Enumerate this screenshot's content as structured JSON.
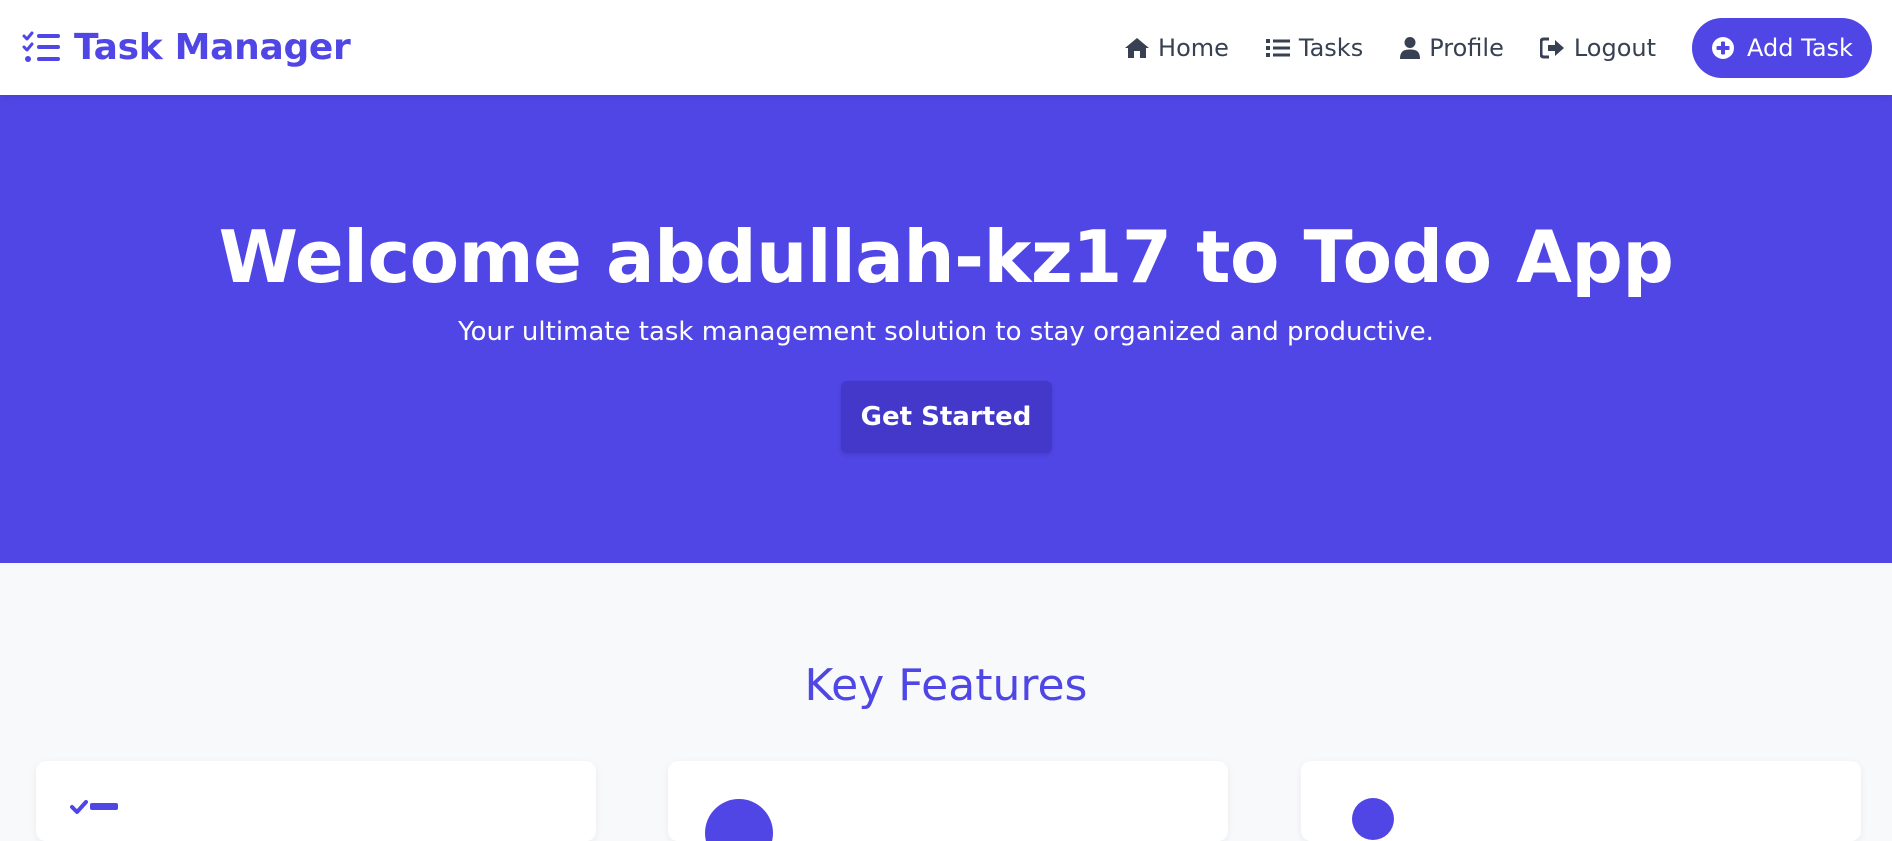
{
  "navbar": {
    "brand": "Task Manager",
    "links": [
      {
        "label": "Home",
        "icon": "home-icon"
      },
      {
        "label": "Tasks",
        "icon": "list-icon"
      },
      {
        "label": "Profile",
        "icon": "user-icon"
      },
      {
        "label": "Logout",
        "icon": "logout-icon"
      }
    ],
    "add_button": "Add Task"
  },
  "hero": {
    "title": "Welcome abdullah-kz17 to Todo App",
    "subtitle": "Your ultimate task management solution to stay organized and productive.",
    "button": "Get Started"
  },
  "features": {
    "title": "Key Features"
  },
  "colors": {
    "primary": "#4f46e5",
    "primary_dark": "#4338ca",
    "text_dark": "#374151",
    "background": "#f8f9fb"
  }
}
